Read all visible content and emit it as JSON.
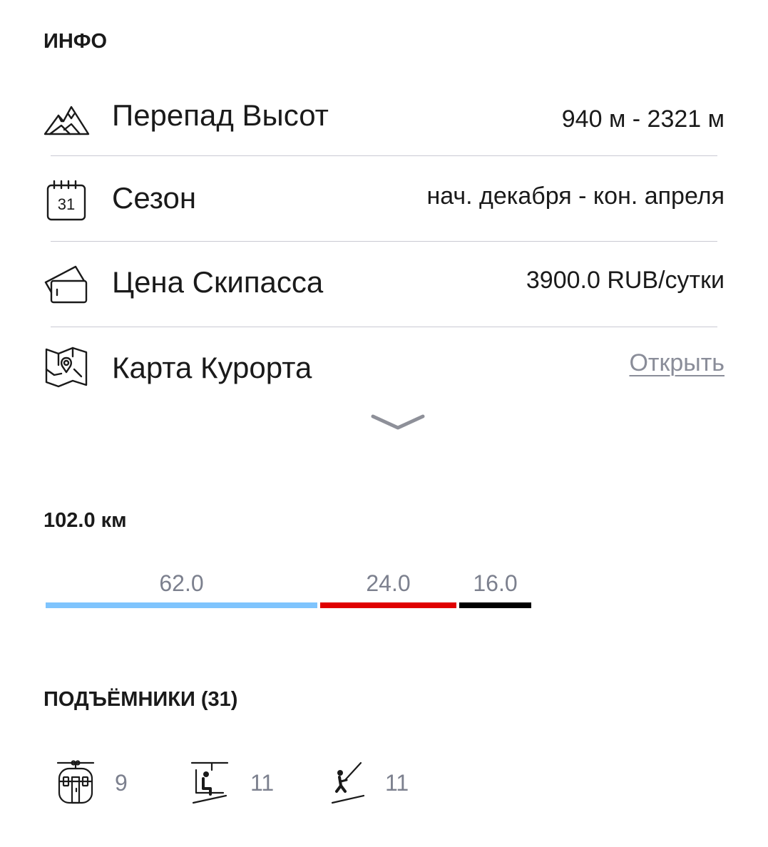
{
  "info": {
    "title": "ИНФО",
    "rows": [
      {
        "icon": "mountain-icon",
        "label": "Перепад Высот",
        "value": "940 м - 2321 м"
      },
      {
        "icon": "calendar-icon",
        "label": "Сезон",
        "value": "нач. декабря - кон. апреля",
        "calendar_day": "31"
      },
      {
        "icon": "ski-pass-icon",
        "label": "Цена Скипасса",
        "value": "3900.0 RUB/сутки"
      },
      {
        "icon": "map-icon",
        "label": "Карта Курорта",
        "value": "Открыть"
      }
    ],
    "expand_icon": "chevron-down-icon"
  },
  "slopes": {
    "total": "102.0 км",
    "segments": [
      {
        "value": "62.0",
        "color": "#7fc4fd"
      },
      {
        "value": "24.0",
        "color": "#e00000"
      },
      {
        "value": "16.0",
        "color": "#000000"
      }
    ]
  },
  "lifts": {
    "title": "ПОДЪЁМНИКИ (31)",
    "items": [
      {
        "icon": "gondola-icon",
        "count": "9"
      },
      {
        "icon": "chairlift-icon",
        "count": "11"
      },
      {
        "icon": "surface-lift-icon",
        "count": "11"
      }
    ]
  }
}
